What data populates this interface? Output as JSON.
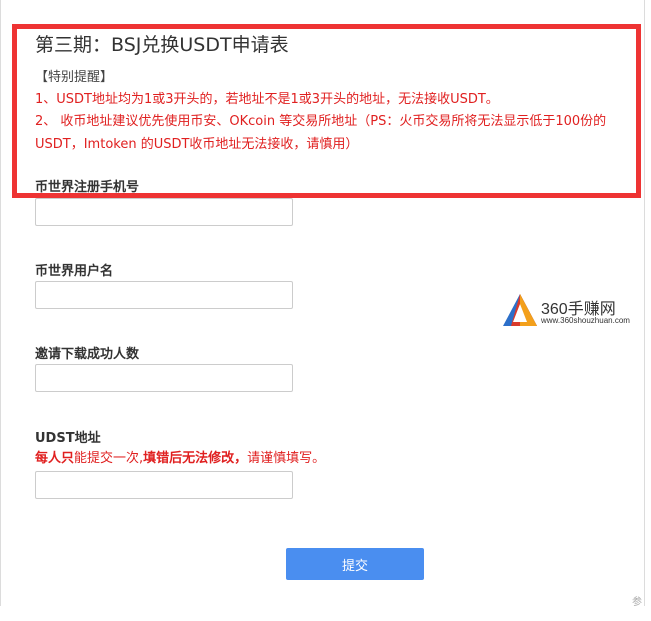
{
  "form": {
    "title": "第三期：BSJ兑换USDT申请表",
    "notice_heading": "【特别提醒】",
    "notice_lines": [
      "1、USDT地址均为1或3开头的，若地址不是1或3开头的地址，无法接收USDT。",
      "2、 收币地址建议优先使用币安、OKcoin 等交易所地址（PS：火币交易所将无法显示低于100份的",
      "USDT，Imtoken 的USDT收币地址无法接收，请慎用）"
    ],
    "fields": {
      "phone_label": "币世界注册手机号",
      "phone_value": "",
      "username_label": "币世界用户名",
      "username_value": "",
      "invites_label": "邀请下载成功人数",
      "invites_value": "",
      "udst_label": "UDST地址",
      "udst_value": "",
      "udst_note_bold_1": "每人只",
      "udst_note_normal_1": "能提交一次,",
      "udst_note_bold_2": "填错后无法修改，",
      "udst_note_normal_2": "请谨慎填写。"
    },
    "submit_label": "提交"
  },
  "watermark": {
    "brand": "360手赚网",
    "url": "www.360shouzhuan.com"
  },
  "corner_char": "参",
  "colors": {
    "notice_red": "#e02020",
    "highlight_border": "#ee3333",
    "submit_bg": "#4a8ef0"
  }
}
